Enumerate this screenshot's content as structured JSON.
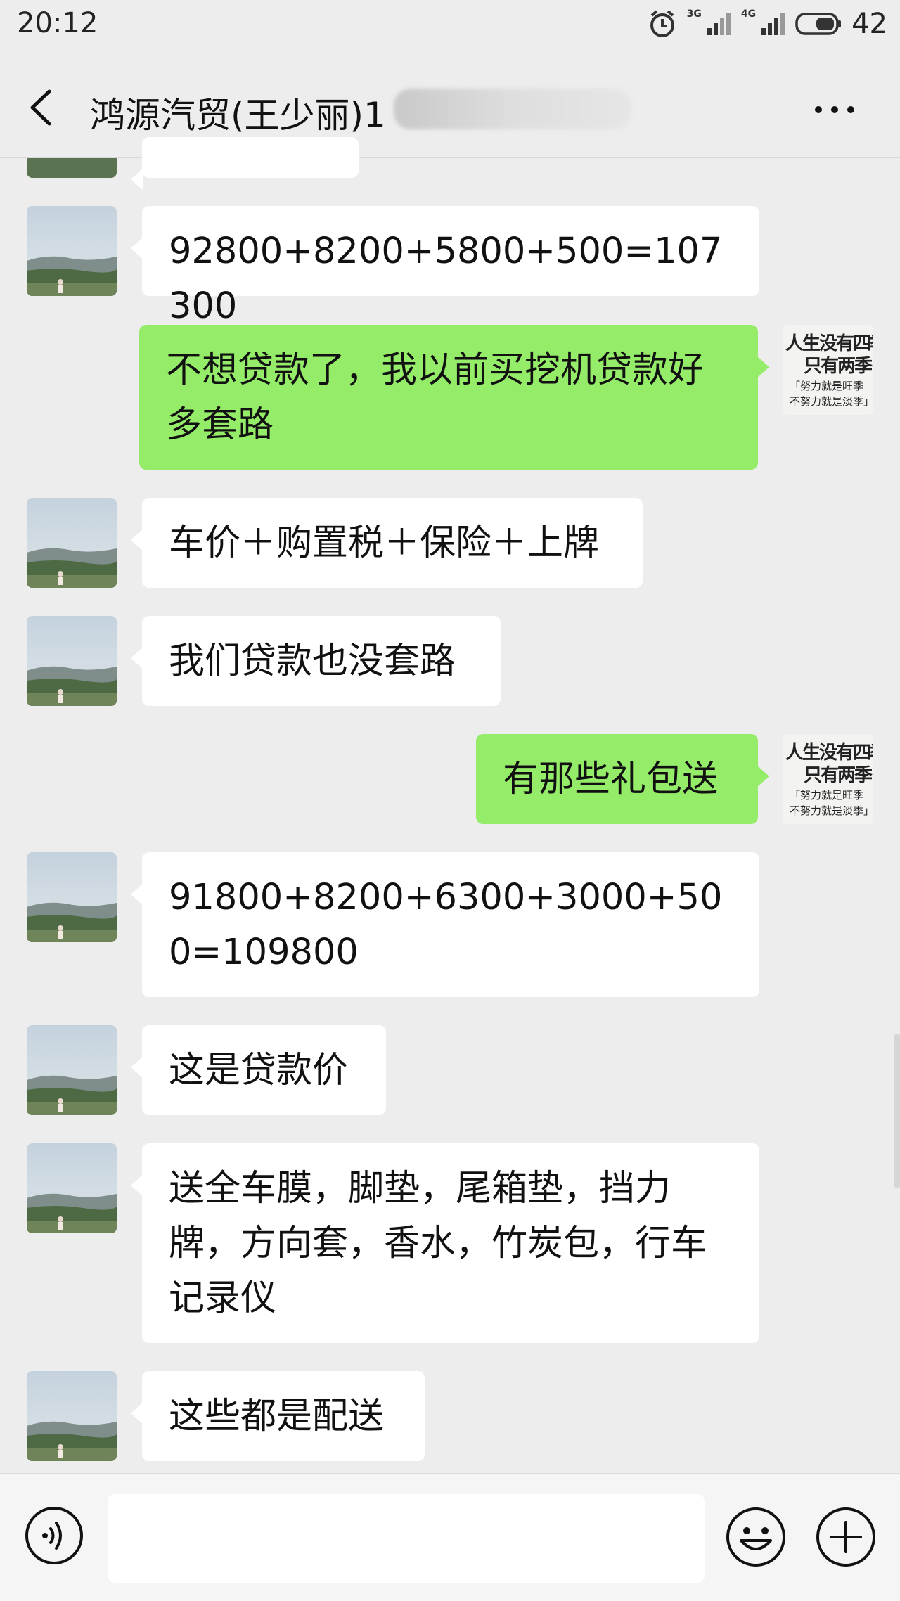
{
  "status_bar": {
    "time": "20:12",
    "net1": "3G",
    "net2": "4G",
    "battery": "42"
  },
  "header": {
    "title": "鸿源汽贸(王少丽)1"
  },
  "my_avatar_text": {
    "line1": "人生没有四季",
    "line2": "只有两季",
    "line3": "「努力就是旺季",
    "line4": "不努力就是淡季」"
  },
  "messages": [
    {
      "side": "in",
      "text": "92800+8200+5800+500=107300"
    },
    {
      "side": "out",
      "text": "不想贷款了，我以前买挖机贷款好多套路"
    },
    {
      "side": "in",
      "text": "车价＋购置税＋保险＋上牌"
    },
    {
      "side": "in",
      "text": "我们贷款也没套路"
    },
    {
      "side": "out",
      "text": "有那些礼包送"
    },
    {
      "side": "in",
      "text": "91800+8200+6300+3000+500=109800"
    },
    {
      "side": "in",
      "text": "这是贷款价"
    },
    {
      "side": "in",
      "text": "送全车膜，脚垫，尾箱垫，挡力牌，方向套，香水，竹炭包，行车记录仪"
    },
    {
      "side": "in",
      "text": "这些都是配送"
    }
  ],
  "input": {
    "placeholder": ""
  }
}
